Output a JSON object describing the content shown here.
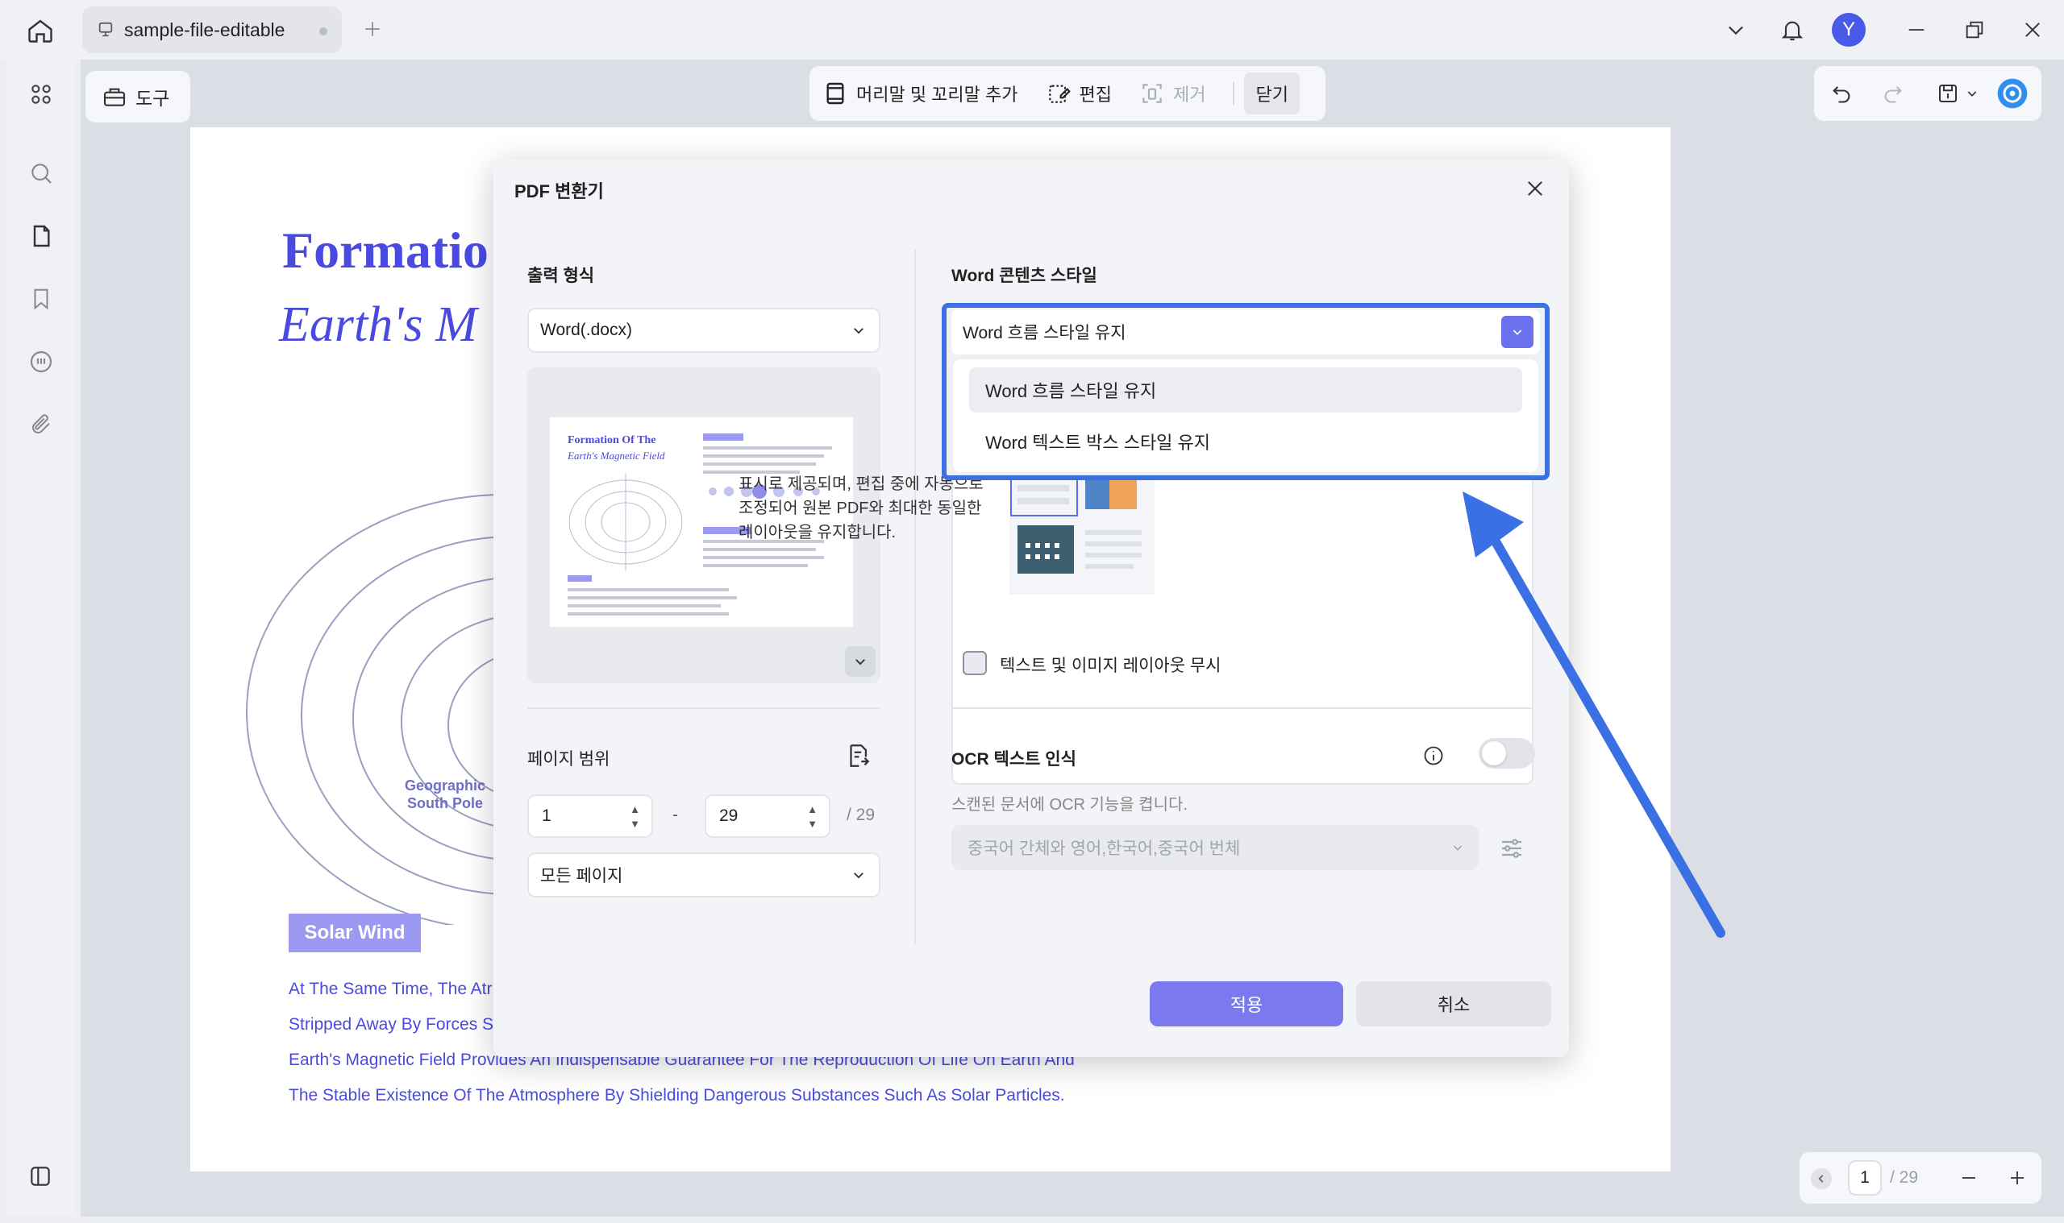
{
  "titlebar": {
    "tab_label": "sample-file-editable",
    "avatar_letter": "Y"
  },
  "toolbar": {
    "tools_label": "도구",
    "header_footer_label": "머리말 및 꼬리말 추가",
    "edit_label": "편집",
    "remove_label": "제거",
    "close_label": "닫기"
  },
  "document": {
    "title_line1": "Formatio",
    "title_line2": "Earth's M",
    "geo_label_line1": "Geographic",
    "geo_label_line2": "South Pole",
    "solar_badge": "Solar Wind",
    "body_lines": [
      "At The Same Time, The Atr",
      "Stripped Away By Forces S",
      "Earth's Magnetic Field Provides An Indispensable Guarantee For The Reproduction Of Life On Earth And",
      "The Stable Existence Of The Atmosphere By Shielding Dangerous Substances Such As Solar Particles."
    ]
  },
  "pager": {
    "current": "1",
    "total": "/ 29"
  },
  "dialog": {
    "title": "PDF 변환기",
    "output_format_label": "출력 형식",
    "output_format_value": "Word(.docx)",
    "page_range_label": "페이지 범위",
    "range_from": "1",
    "range_dash": "-",
    "range_to": "29",
    "range_total": "/ 29",
    "page_subset": "모든 페이지",
    "word_style_label": "Word 콘텐츠 스타일",
    "word_style_selected": "Word 흐름 스타일 유지",
    "word_style_options": [
      "Word 흐름 스타일 유지",
      "Word 텍스트 박스 스타일 유지"
    ],
    "style_desc_line1": "표시로 제공되며, 편집 중에 자동으로",
    "style_desc_line2": "조정되어 원본 PDF와 최대한 동일한",
    "style_desc_line3": "레이아웃을 유지합니다.",
    "ignore_layout_label": "텍스트 및 이미지 레이아웃 무시",
    "ocr_label": "OCR 텍스트 인식",
    "ocr_desc": "스캔된 문서에 OCR 기능을 켭니다.",
    "ocr_languages": "중국어 간체와 영어,한국어,중국어 번체",
    "apply_label": "적용",
    "cancel_label": "취소"
  },
  "colors": {
    "accent": "#7a79ef",
    "dropdown_border": "#3b6fe4",
    "doc_blue": "#4b4ae0"
  }
}
